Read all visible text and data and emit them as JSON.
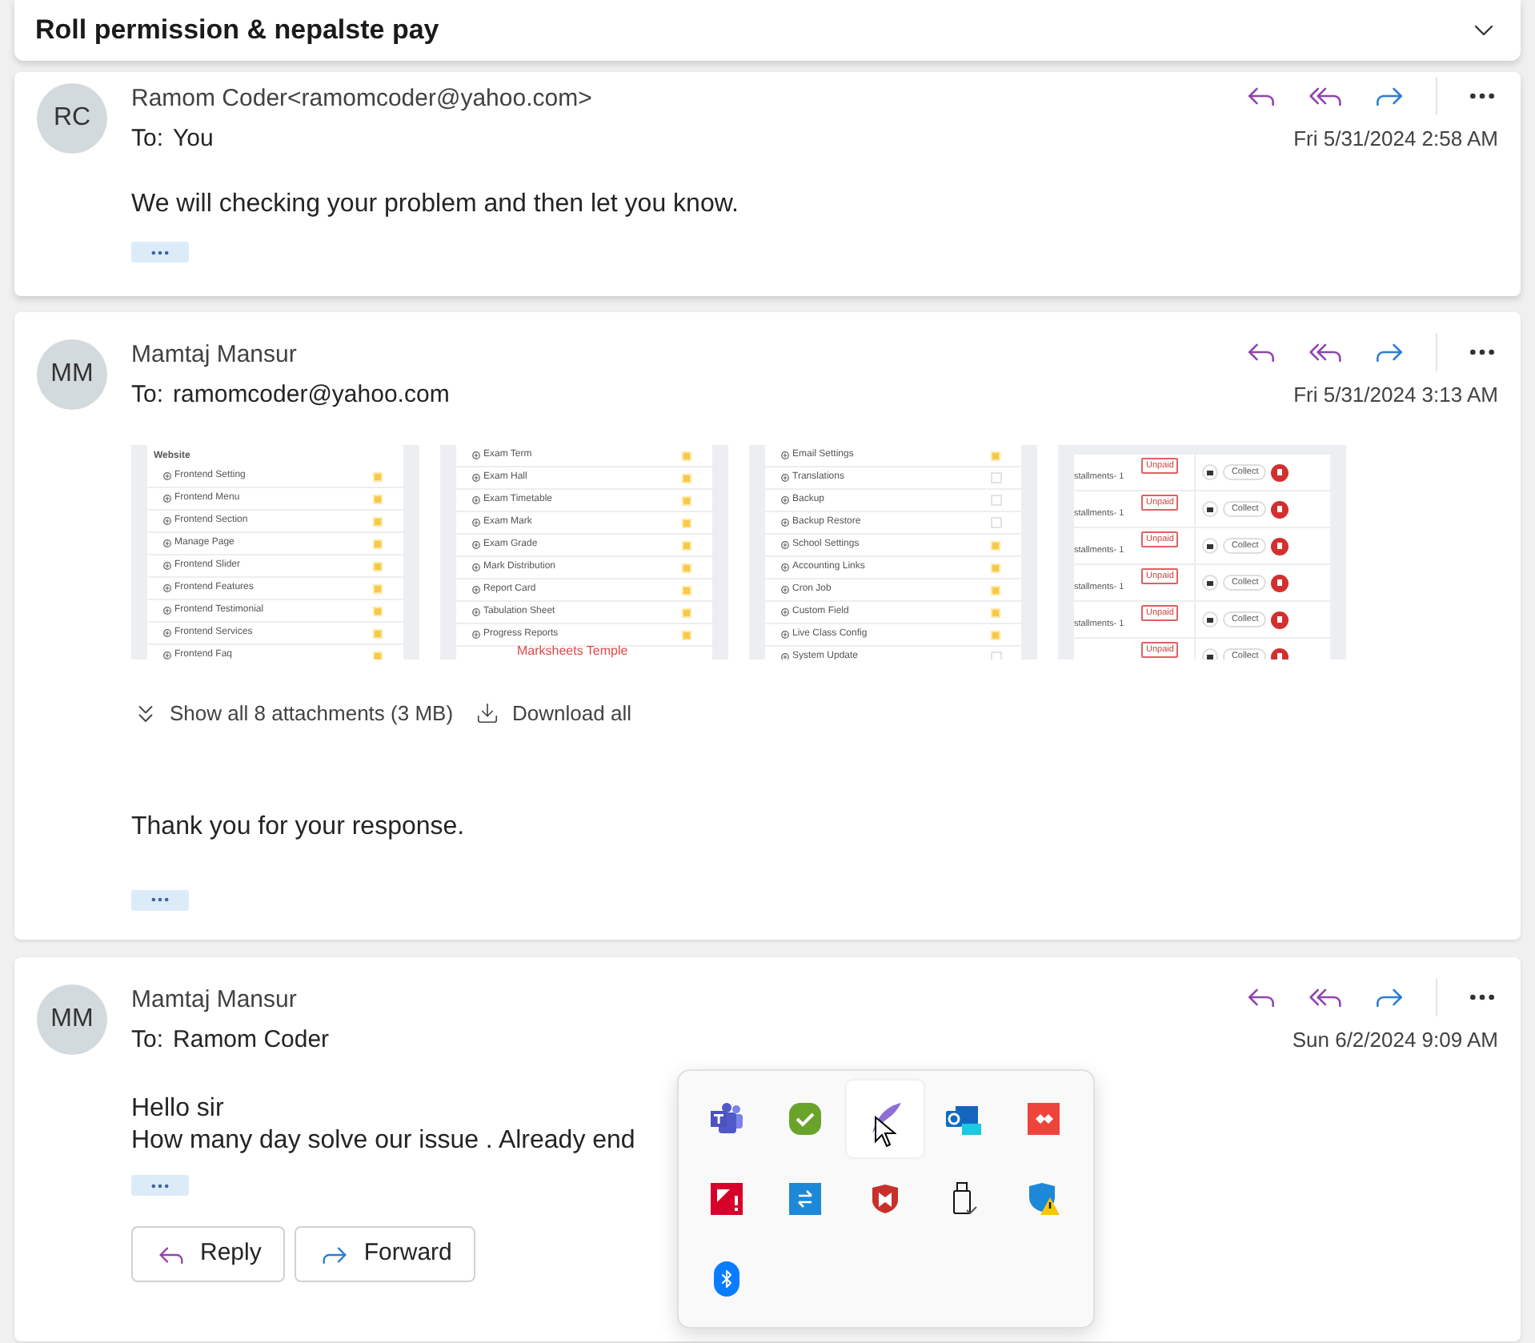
{
  "thread": {
    "subject": "Roll permission & nepalste pay",
    "expanded": true
  },
  "messages": [
    {
      "initials": "RC",
      "sender": "Ramom Coder<ramomcoder@yahoo.com>",
      "to_label": "To:",
      "to": "You",
      "date": "Fri 5/31/2024 2:58 AM",
      "body": [
        "We will checking your problem and then let you know."
      ]
    },
    {
      "initials": "MM",
      "sender": "Mamtaj Mansur",
      "to_label": "To:",
      "to": "ramomcoder@yahoo.com",
      "date": "Fri 5/31/2024 3:13 AM",
      "attachments": [
        {
          "kind": "permissions",
          "heading": "Website",
          "rows": [
            {
              "label": "Frontend Setting",
              "checked": true
            },
            {
              "label": "Frontend Menu",
              "checked": true
            },
            {
              "label": "Frontend Section",
              "checked": true
            },
            {
              "label": "Manage Page",
              "checked": true
            },
            {
              "label": "Frontend Slider",
              "checked": true
            },
            {
              "label": "Frontend Features",
              "checked": true
            },
            {
              "label": "Frontend Testimonial",
              "checked": true
            },
            {
              "label": "Frontend Services",
              "checked": true
            },
            {
              "label": "Frontend Faq",
              "checked": true
            }
          ]
        },
        {
          "kind": "permissions",
          "overlay": "Marksheets Temple",
          "rows": [
            {
              "label": "Exam Term",
              "checked": true
            },
            {
              "label": "Exam Hall",
              "checked": true
            },
            {
              "label": "Exam Timetable",
              "checked": true
            },
            {
              "label": "Exam Mark",
              "checked": true
            },
            {
              "label": "Exam Grade",
              "checked": true
            },
            {
              "label": "Mark Distribution",
              "checked": true
            },
            {
              "label": "Report Card",
              "checked": true
            },
            {
              "label": "Tabulation Sheet",
              "checked": true
            },
            {
              "label": "Progress Reports",
              "checked": true
            }
          ]
        },
        {
          "kind": "permissions",
          "rows": [
            {
              "label": "Email Settings",
              "checked": true
            },
            {
              "label": "Translations",
              "checked": false
            },
            {
              "label": "Backup",
              "checked": false
            },
            {
              "label": "Backup Restore",
              "checked": false
            },
            {
              "label": "School Settings",
              "checked": true
            },
            {
              "label": "Accounting Links",
              "checked": true
            },
            {
              "label": "Cron Job",
              "checked": true
            },
            {
              "label": "Custom Field",
              "checked": true
            },
            {
              "label": "Live Class Config",
              "checked": true
            },
            {
              "label": "System Update",
              "checked": false
            }
          ]
        },
        {
          "kind": "fees",
          "rows": [
            {
              "label": "stallments- 1",
              "status": "Unpaid",
              "action": "Collect"
            },
            {
              "label": "stallments- 1",
              "status": "Unpaid",
              "action": "Collect"
            },
            {
              "label": "stallments- 1",
              "status": "Unpaid",
              "action": "Collect"
            },
            {
              "label": "stallments- 1",
              "status": "Unpaid",
              "action": "Collect"
            },
            {
              "label": "stallments- 1",
              "status": "Unpaid",
              "action": "Collect"
            },
            {
              "status": "Unpaid",
              "action": "Collect"
            }
          ]
        }
      ],
      "show_all": "Show all 8 attachments (3 MB)",
      "download_all": "Download all",
      "body": [
        "Thank you for your response."
      ]
    },
    {
      "initials": "MM",
      "sender": "Mamtaj Mansur",
      "to_label": "To:",
      "to": "Ramom Coder",
      "date": "Sun 6/2/2024 9:09 AM",
      "body": [
        "Hello sir",
        "How many day solve our issue . Already end"
      ],
      "actions": [
        "Reply",
        "Forward"
      ]
    }
  ],
  "tray": {
    "items": [
      {
        "hovered": false
      },
      {
        "hovered": false
      },
      {
        "hovered": true
      },
      {
        "hovered": false
      },
      {
        "hovered": false
      },
      {
        "hovered": false
      },
      {
        "hovered": false
      },
      {
        "hovered": false
      },
      {
        "hovered": false
      },
      {
        "hovered": false
      },
      {
        "hovered": false
      }
    ]
  }
}
